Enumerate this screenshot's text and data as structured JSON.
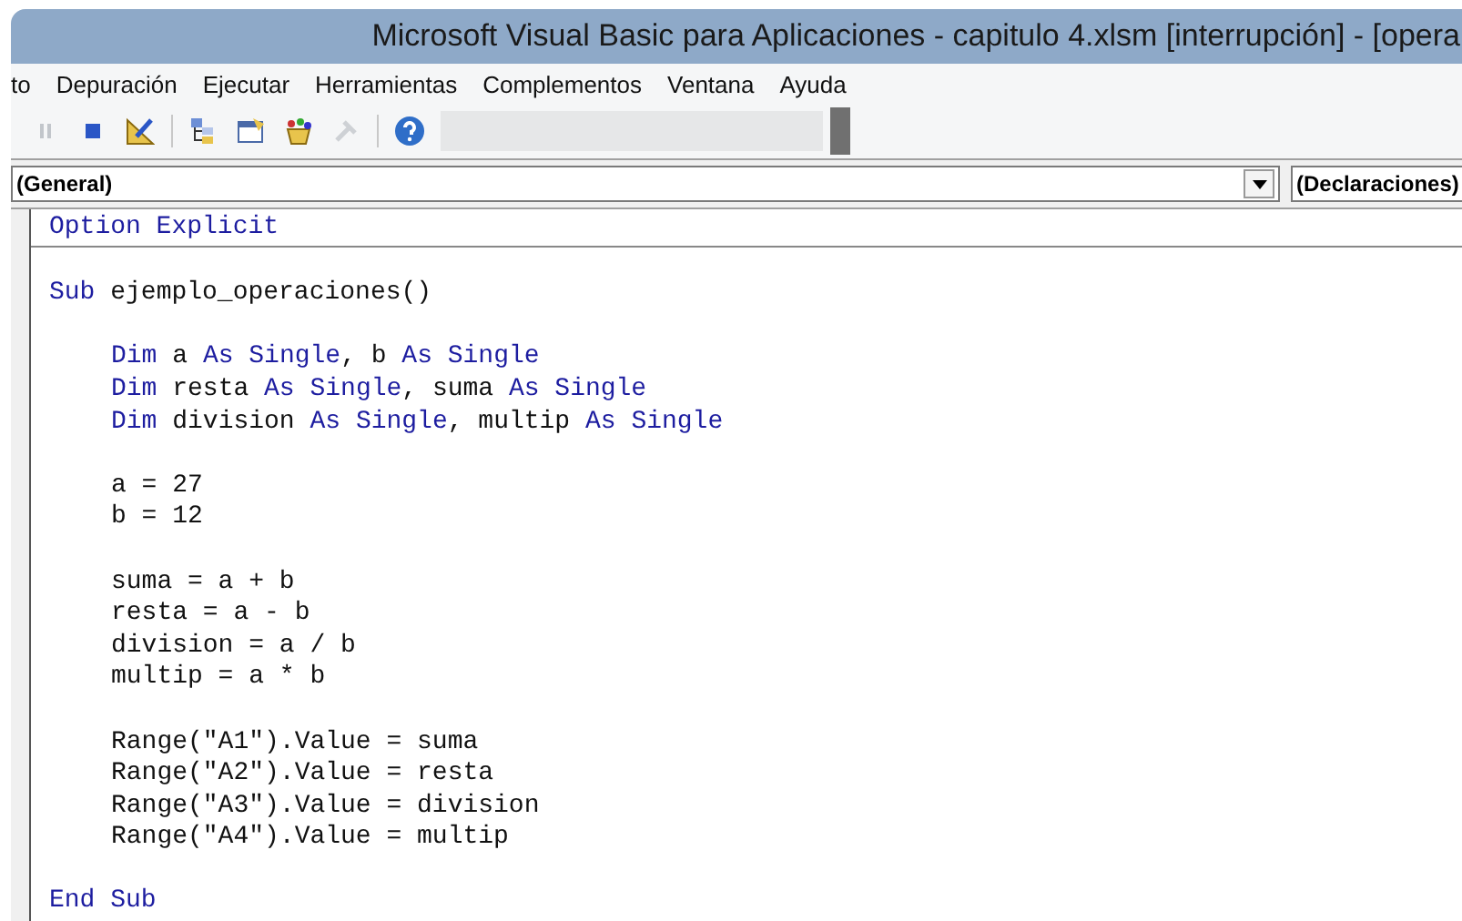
{
  "window": {
    "title": "Microsoft Visual Basic para Aplicaciones - capitulo 4.xlsm [interrupción] - [opera"
  },
  "menu": [
    {
      "label": "to"
    },
    {
      "label": "Depuración"
    },
    {
      "label": "Ejecutar"
    },
    {
      "label": "Herramientas"
    },
    {
      "label": "Complementos"
    },
    {
      "label": "Ventana"
    },
    {
      "label": "Ayuda"
    }
  ],
  "toolbar": [
    {
      "kind": "pause",
      "disabled": true
    },
    {
      "kind": "stop",
      "disabled": false
    },
    {
      "kind": "design",
      "disabled": false
    },
    {
      "kind": "separator"
    },
    {
      "kind": "project",
      "disabled": false
    },
    {
      "kind": "properties",
      "disabled": false
    },
    {
      "kind": "browser",
      "disabled": false
    },
    {
      "kind": "toolbox",
      "disabled": true
    },
    {
      "kind": "separator"
    },
    {
      "kind": "help",
      "disabled": false
    }
  ],
  "object_dropdown": {
    "value": "(General)"
  },
  "procedure_dropdown": {
    "value": "(Declaraciones)"
  },
  "code": {
    "declarations": [
      {
        "kind": "code",
        "indented": false,
        "tokens": [
          {
            "text": "Option Explicit",
            "keyword": true
          }
        ]
      }
    ],
    "lines": [
      {
        "kind": "blank"
      },
      {
        "kind": "code",
        "indented": false,
        "tokens": [
          {
            "text": "Sub",
            "keyword": true
          },
          {
            "text": " ejemplo_operaciones()",
            "keyword": false
          }
        ]
      },
      {
        "kind": "blank"
      },
      {
        "kind": "code",
        "indented": true,
        "tokens": [
          {
            "text": "Dim",
            "keyword": true
          },
          {
            "text": " a ",
            "keyword": false
          },
          {
            "text": "As Single",
            "keyword": true
          },
          {
            "text": ", b ",
            "keyword": false
          },
          {
            "text": "As Single",
            "keyword": true
          }
        ]
      },
      {
        "kind": "code",
        "indented": true,
        "tokens": [
          {
            "text": "Dim",
            "keyword": true
          },
          {
            "text": " resta ",
            "keyword": false
          },
          {
            "text": "As Single",
            "keyword": true
          },
          {
            "text": ", suma ",
            "keyword": false
          },
          {
            "text": "As Single",
            "keyword": true
          }
        ]
      },
      {
        "kind": "code",
        "indented": true,
        "tokens": [
          {
            "text": "Dim",
            "keyword": true
          },
          {
            "text": " division ",
            "keyword": false
          },
          {
            "text": "As Single",
            "keyword": true
          },
          {
            "text": ", multip ",
            "keyword": false
          },
          {
            "text": "As Single",
            "keyword": true
          }
        ]
      },
      {
        "kind": "blank"
      },
      {
        "kind": "code",
        "indented": true,
        "tokens": [
          {
            "text": "a = 27",
            "keyword": false
          }
        ]
      },
      {
        "kind": "code",
        "indented": true,
        "tokens": [
          {
            "text": "b = 12",
            "keyword": false
          }
        ]
      },
      {
        "kind": "blank"
      },
      {
        "kind": "code",
        "indented": true,
        "tokens": [
          {
            "text": "suma = a + b",
            "keyword": false
          }
        ]
      },
      {
        "kind": "code",
        "indented": true,
        "tokens": [
          {
            "text": "resta = a - b",
            "keyword": false
          }
        ]
      },
      {
        "kind": "code",
        "indented": true,
        "tokens": [
          {
            "text": "division = a / b",
            "keyword": false
          }
        ]
      },
      {
        "kind": "code",
        "indented": true,
        "tokens": [
          {
            "text": "multip = a * b",
            "keyword": false
          }
        ]
      },
      {
        "kind": "blank"
      },
      {
        "kind": "code",
        "indented": true,
        "tokens": [
          {
            "text": "Range(\"A1\").Value = suma",
            "keyword": false
          }
        ]
      },
      {
        "kind": "code",
        "indented": true,
        "tokens": [
          {
            "text": "Range(\"A2\").Value = resta",
            "keyword": false
          }
        ]
      },
      {
        "kind": "code",
        "indented": true,
        "tokens": [
          {
            "text": "Range(\"A3\").Value = division",
            "keyword": false
          }
        ]
      },
      {
        "kind": "code",
        "indented": true,
        "tokens": [
          {
            "text": "Range(\"A4\").Value = multip",
            "keyword": false
          }
        ]
      },
      {
        "kind": "blank"
      },
      {
        "kind": "code",
        "indented": false,
        "tokens": [
          {
            "text": "End Sub",
            "keyword": true
          }
        ]
      }
    ]
  }
}
